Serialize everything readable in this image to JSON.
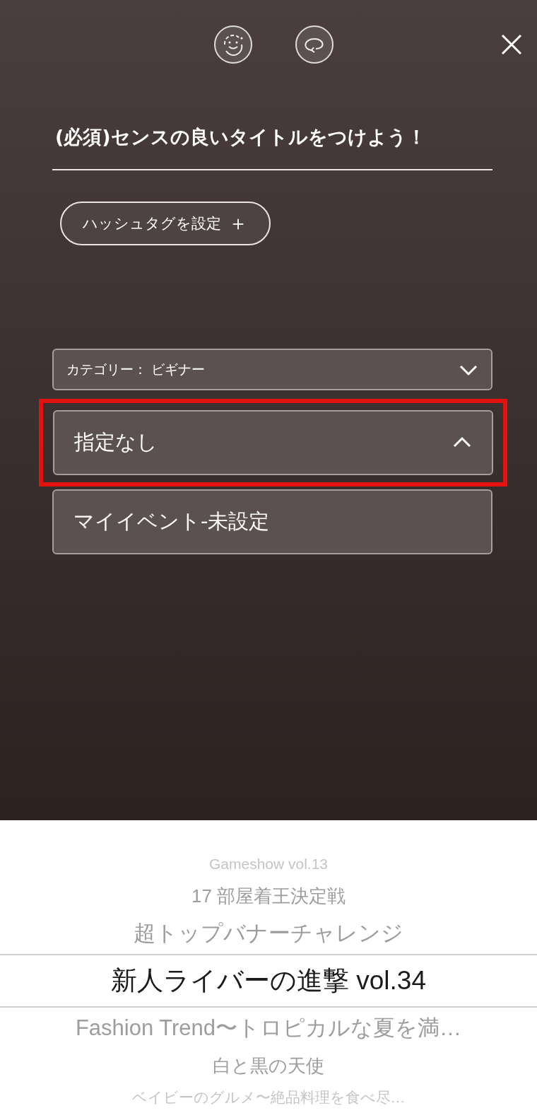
{
  "title_field": {
    "placeholder": "(必須)センスの良いタイトルをつけよう！"
  },
  "hashtag_button": {
    "label": "ハッシュタグを設定",
    "icon": "＋"
  },
  "dropdowns": [
    {
      "label": "カテゴリー： ビギナー",
      "kind": "compact",
      "expanded": false,
      "highlighted": false
    },
    {
      "label": "指定なし",
      "kind": "large",
      "expanded": true,
      "highlighted": true
    },
    {
      "label": "マイイベント-未設定",
      "kind": "plain"
    }
  ],
  "picker": {
    "items": [
      {
        "label": "Gameshow vol.13",
        "selected": false
      },
      {
        "label": "17 部屋着王決定戦",
        "selected": false
      },
      {
        "label": "超トップバナーチャレンジ",
        "selected": false
      },
      {
        "label": "新人ライバーの進撃 vol.34",
        "selected": true
      },
      {
        "label": "Fashion Trend〜トロピカルな夏を満…",
        "selected": false
      },
      {
        "label": "白と黒の天使",
        "selected": false
      },
      {
        "label": "ベイビーのグルメ〜絶品料理を食べ尽…",
        "selected": false
      }
    ]
  }
}
